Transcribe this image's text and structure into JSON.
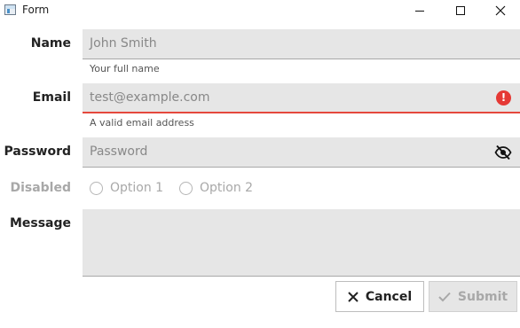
{
  "window": {
    "title": "Form",
    "icons": [
      "app-icon",
      "minimize-icon",
      "maximize-icon",
      "close-icon"
    ]
  },
  "form": {
    "name": {
      "label": "Name",
      "value": "John Smith",
      "help": "Your full name"
    },
    "email": {
      "label": "Email",
      "placeholder": "test@example.com",
      "help": "A valid email address",
      "status_icon": "error-icon",
      "error_color": "#e5483d"
    },
    "password": {
      "label": "Password",
      "placeholder": "Password",
      "toggle_icon": "eye-slash-icon"
    },
    "disabled": {
      "label": "Disabled",
      "options": [
        "Option 1",
        "Option 2"
      ]
    },
    "message": {
      "label": "Message",
      "value": ""
    }
  },
  "actions": {
    "cancel_label": "Cancel",
    "submit_label": "Submit"
  },
  "colors": {
    "field_bg": "#e6e6e6",
    "error": "#e53935",
    "disabled_text": "#a8a8a8"
  }
}
